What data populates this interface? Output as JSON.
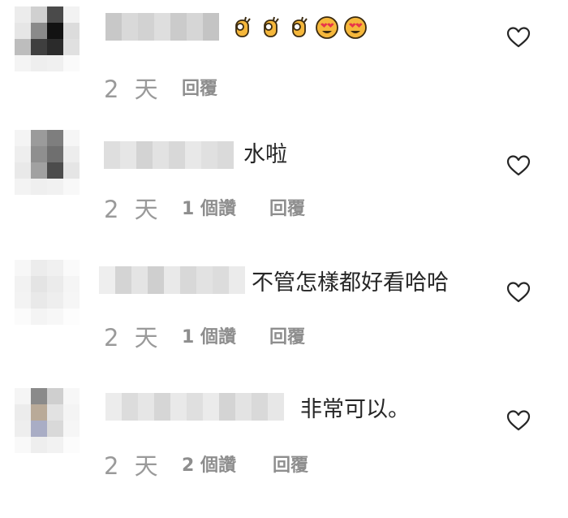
{
  "comments": [
    {
      "username": "",
      "text": "",
      "emoji_icons": [
        "ok-hand-icon",
        "ok-hand-icon",
        "ok-hand-icon",
        "heart-eyes-icon",
        "heart-eyes-icon"
      ],
      "time": "2 天",
      "likes": "",
      "reply": "回覆"
    },
    {
      "username": "",
      "text": "水啦",
      "time": "2 天",
      "likes": "1 個讚",
      "reply": "回覆"
    },
    {
      "username": "",
      "text": "不管怎樣都好看哈哈",
      "time": "2 天",
      "likes": "1 個讚",
      "reply": "回覆"
    },
    {
      "username": "",
      "text": "非常可以。",
      "time": "2 天",
      "likes": "2 個讚",
      "reply": "回覆"
    }
  ],
  "icons": {
    "like": "heart-outline-icon"
  },
  "colors": {
    "text": "#262626",
    "meta": "#8e8e8e",
    "heart": "#262626",
    "emoji_face": "#f5b73b"
  }
}
